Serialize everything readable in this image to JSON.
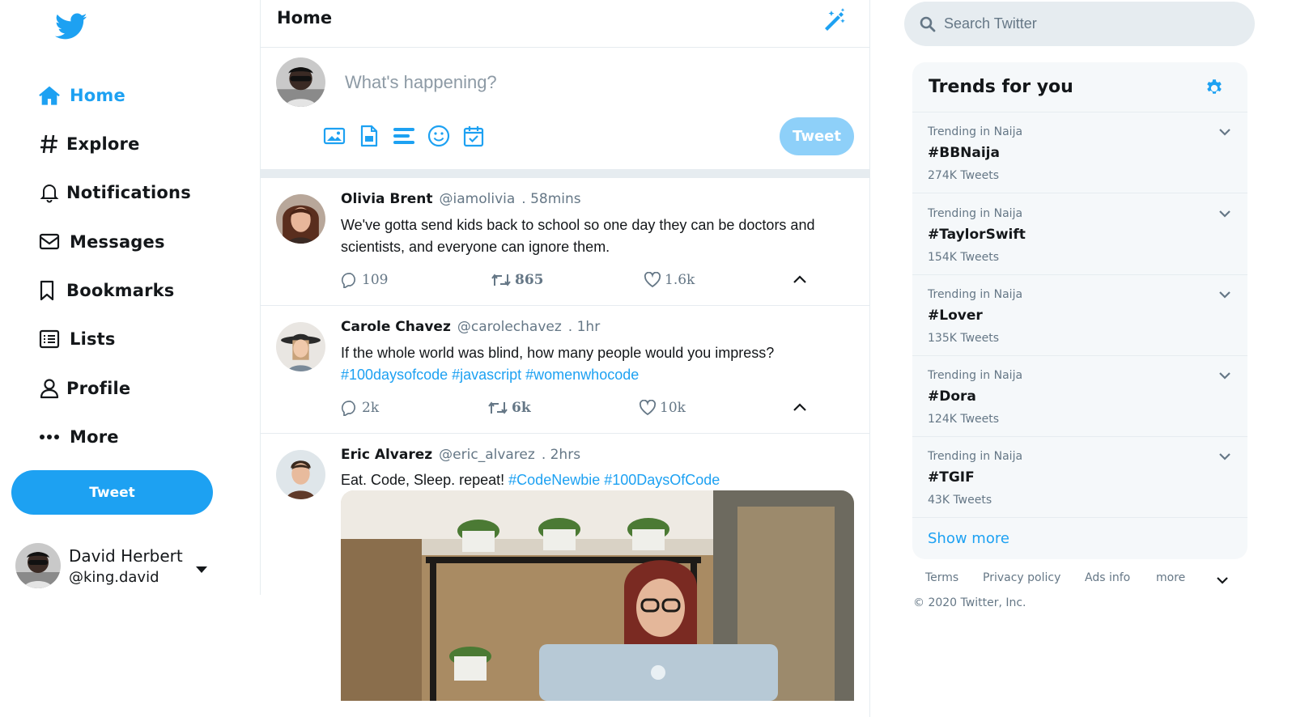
{
  "colors": {
    "brand": "#1da1f2",
    "brand_disabled": "#8ed0f9",
    "text": "#14171a",
    "muted": "#657786",
    "border": "#e6ecf0",
    "panel": "#f5f8fa"
  },
  "sidebar": {
    "logo": "twitter-bird-icon",
    "nav": [
      {
        "label": "Home",
        "icon": "home-icon",
        "active": true
      },
      {
        "label": "Explore",
        "icon": "hashtag-icon"
      },
      {
        "label": "Notifications",
        "icon": "bell-icon"
      },
      {
        "label": "Messages",
        "icon": "envelope-icon"
      },
      {
        "label": "Bookmarks",
        "icon": "bookmark-icon"
      },
      {
        "label": "Lists",
        "icon": "list-icon"
      },
      {
        "label": "Profile",
        "icon": "user-icon"
      },
      {
        "label": "More",
        "icon": "more-dots-icon"
      }
    ],
    "tweet_button": "Tweet",
    "account": {
      "name": "David Herbert",
      "handle": "@king.david"
    }
  },
  "main": {
    "title": "Home",
    "composer": {
      "placeholder": "What's happening?",
      "icons": [
        "image-icon",
        "gif-icon",
        "poll-icon",
        "emoji-icon",
        "schedule-icon"
      ],
      "tweet_button": "Tweet"
    },
    "tweets": [
      {
        "name": "Olivia Brent",
        "handle": "@iamolivia",
        "time": ". 58mins",
        "text": "We've gotta send kids back to school so one day they can be doctors and scientists, and everyone can ignore them.",
        "tags": "",
        "replies": "109",
        "retweets": "865",
        "likes": "1.6k"
      },
      {
        "name": "Carole Chavez",
        "handle": "@carolechavez",
        "time": ". 1hr",
        "text": "If the whole world was blind, how many people would you impress?",
        "tags": "#100daysofcode #javascript #womenwhocode",
        "replies": "2k",
        "retweets": "6k",
        "likes": "10k"
      },
      {
        "name": "Eric Alvarez",
        "handle": "@eric_alvarez",
        "time": ". 2hrs",
        "text": "Eat. Code, Sleep. repeat!",
        "tags": "#CodeNewbie #100DaysOfCode"
      }
    ]
  },
  "right": {
    "search_placeholder": "Search Twitter",
    "trends_title": "Trends for you",
    "trends": [
      {
        "context": "Trending in Naija",
        "tag": "#BBNaija",
        "count": "274K Tweets"
      },
      {
        "context": "Trending in Naija",
        "tag": "#TaylorSwift",
        "count": "154K Tweets"
      },
      {
        "context": "Trending in Naija",
        "tag": "#Lover",
        "count": "135K Tweets"
      },
      {
        "context": "Trending in Naija",
        "tag": "#Dora",
        "count": "124K Tweets"
      },
      {
        "context": "Trending in Naija",
        "tag": "#TGIF",
        "count": "43K Tweets"
      }
    ],
    "show_more": "Show more",
    "footer": {
      "terms": "Terms",
      "privacy": "Privacy policy",
      "ads": "Ads info",
      "more": "more",
      "copyright": "© 2020 Twitter, Inc."
    }
  }
}
